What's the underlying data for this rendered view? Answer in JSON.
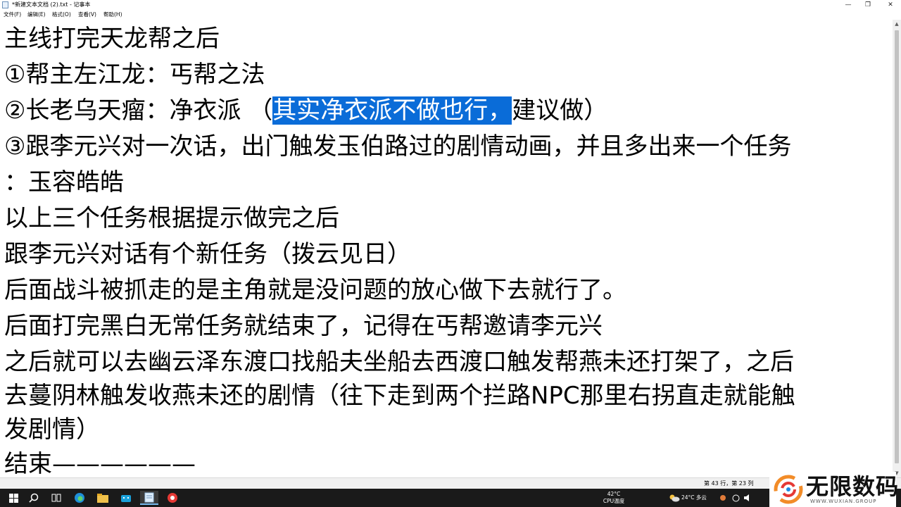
{
  "window": {
    "title": "*新建文本文档 (2).txt - 记事本",
    "controls": {
      "minimize": "—",
      "maximize": "❐",
      "close": "✕"
    }
  },
  "menu": {
    "file": "文件(F)",
    "edit": "编辑(E)",
    "format": "格式(O)",
    "view": "查看(V)",
    "help": "帮助(H)"
  },
  "document": {
    "lines": [
      {
        "text": "主线打完天龙帮之后"
      },
      {
        "text": "①帮主左江龙：丐帮之法"
      },
      {
        "pre": "②长老乌天瘤：净衣派 （",
        "selected": "其实净衣派不做也行，",
        "post": "建议做）"
      },
      {
        "text": "③跟李元兴对一次话，出门触发玉伯路过的剧情动画，并且多出来一个任务"
      },
      {
        "text": "：玉容皓皓"
      },
      {
        "text": "以上三个任务根据提示做完之后"
      },
      {
        "text": "跟李元兴对话有个新任务（拨云见日）"
      },
      {
        "text": "后面战斗被抓走的是主角就是没问题的放心做下去就行了。"
      },
      {
        "text": "后面打完黑白无常任务就结束了，记得在丐帮邀请李元兴"
      },
      {
        "text": "之后就可以去幽云泽东渡口找船夫坐船去西渡口触发帮燕未还打架了，之后"
      },
      {
        "text": "去蔓阴林触发收燕未还的剧情（往下走到两个拦路NPC那里右拐直走就能触"
      },
      {
        "text": "发剧情）"
      },
      {
        "text": "结束——————"
      }
    ]
  },
  "statusbar": {
    "position": "第 43 行，第 23 列"
  },
  "taskbar": {
    "temperature": "42°C",
    "temperature_label": "CPU温度",
    "weather": "24°C 多云"
  },
  "watermark": {
    "brand": "无限数码",
    "url": "WWW.WUXIAN.GROUP"
  },
  "colors": {
    "selection": "#0a6cd8",
    "taskbar": "#1a1a1a",
    "statusbar": "#f0f0f0"
  }
}
